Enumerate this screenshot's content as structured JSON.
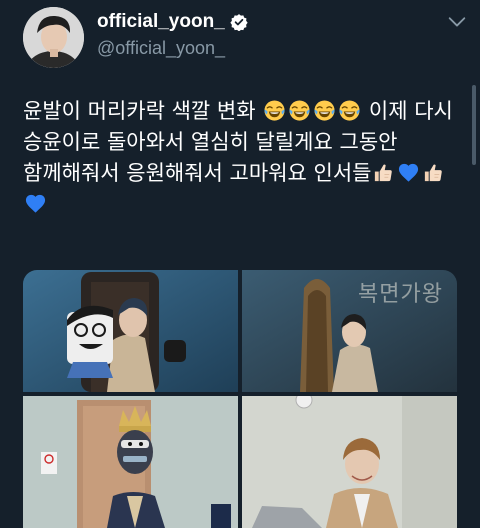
{
  "user": {
    "display_name": "official_yoon_",
    "handle": "@official_yoon_",
    "verified": true
  },
  "tweet": {
    "text_segments": [
      "윤발이 머리카락 색깔 변화 ",
      " 이제 다시 승윤이로 돌아와서 열심히 달릴게요 그동안 함께해줘서 응원해줘서 고마워요 인서들"
    ],
    "emojis": [
      "face-with-tears-of-joy",
      "thumbs-up",
      "blue-heart"
    ]
  },
  "photos": [
    {
      "id": "photo-1",
      "overlay_text": ""
    },
    {
      "id": "photo-2",
      "overlay_text": "복면가왕"
    },
    {
      "id": "photo-3",
      "overlay_text": ""
    },
    {
      "id": "photo-4",
      "overlay_text": ""
    }
  ],
  "colors": {
    "background": "#15202b",
    "text": "#ffffff",
    "secondary_text": "#8899a6",
    "verified_blue": "#1da1f2",
    "heart_blue": "#2f7ff5"
  }
}
